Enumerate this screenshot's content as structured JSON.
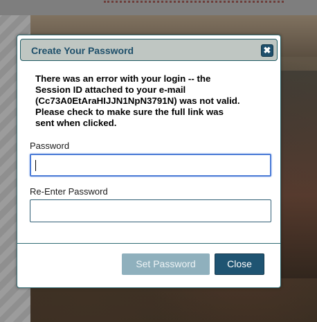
{
  "modal": {
    "title": "Create Your Password",
    "close_icon": "close-icon",
    "error_message": "There was an error with your login -- the\nSession ID attached to your e-mail\n(Cc73A0EtAraHIJJN1NpN3791N) was not valid.\nPlease check to make sure the full link was\nsent when clicked.",
    "password_label": "Password",
    "password_value": "",
    "reenter_label": "Re-Enter Password",
    "reenter_value": "",
    "set_password_label": "Set Password",
    "close_label": "Close"
  },
  "colors": {
    "titlebar_bg": "#bfc6c2",
    "title_text": "#1e4f6a",
    "primary_button": "#1f5472",
    "disabled_button": "#8fb0bd",
    "focus_border": "#4b7bd6"
  }
}
